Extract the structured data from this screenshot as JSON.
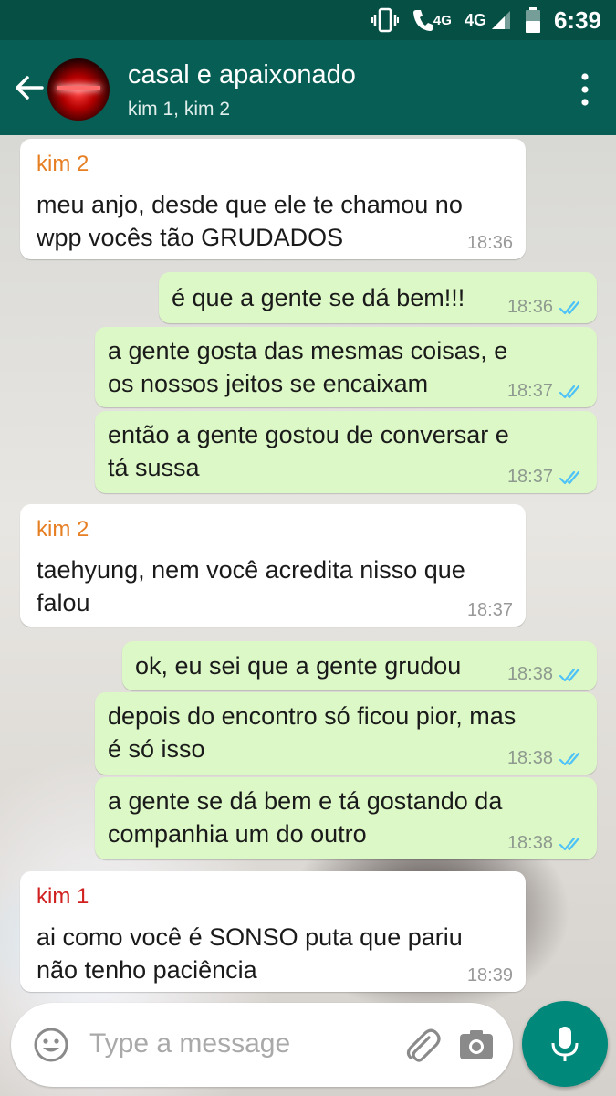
{
  "status_bar": {
    "network_a": "4G",
    "network_b": "4G",
    "time": "6:39"
  },
  "header": {
    "title": "casal e apaixonado",
    "subtitle": "kim 1, kim 2"
  },
  "messages": [
    {
      "dir": "in",
      "sender": "kim 2",
      "sender_color": "#e67e22",
      "lines": [
        "meu anjo, desde que ele te chamou no",
        "wpp vocês tão GRUDADOS"
      ],
      "time": "18:36"
    },
    {
      "dir": "out",
      "lines": [
        "é que a gente se dá bem!!!"
      ],
      "time": "18:36"
    },
    {
      "dir": "out",
      "lines": [
        "a gente gosta das mesmas coisas, e",
        "os nossos jeitos se encaixam"
      ],
      "time": "18:37"
    },
    {
      "dir": "out",
      "lines": [
        "então a gente gostou de conversar e",
        "tá sussa"
      ],
      "time": "18:37"
    },
    {
      "dir": "in",
      "sender": "kim 2",
      "sender_color": "#e67e22",
      "lines": [
        "taehyung, nem você acredita nisso que",
        "falou"
      ],
      "time": "18:37"
    },
    {
      "dir": "out",
      "lines": [
        "ok, eu sei que a gente grudou"
      ],
      "time": "18:38"
    },
    {
      "dir": "out",
      "lines": [
        "depois do encontro só ficou pior, mas",
        "é só isso"
      ],
      "time": "18:38"
    },
    {
      "dir": "out",
      "lines": [
        "a gente se dá bem e tá gostando da",
        "companhia um do outro"
      ],
      "time": "18:38"
    },
    {
      "dir": "in",
      "sender": "kim 1",
      "sender_color": "#d0201f",
      "lines": [
        "ai como você é SONSO puta que pariu",
        "não tenho paciência"
      ],
      "time": "18:39"
    }
  ],
  "input": {
    "placeholder": "Type a message"
  },
  "colors": {
    "header": "#075e54",
    "status_bar": "#064f45",
    "outgoing_bubble": "#dcf8c6",
    "incoming_bubble": "#ffffff",
    "read_ticks": "#4fc3f7",
    "mic_button": "#00897b"
  }
}
